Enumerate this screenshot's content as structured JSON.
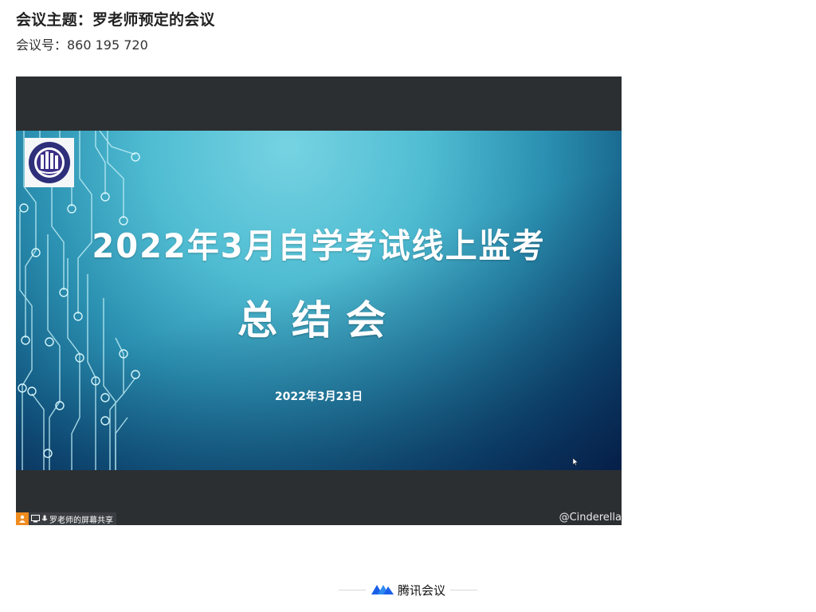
{
  "meeting": {
    "title": "会议主题：罗老师预定的会议",
    "id_line": "会议号：860 195 720"
  },
  "slide": {
    "title": "2022年3月自学考试线上监考",
    "subtitle": "总结会",
    "date": "2022年3月23日"
  },
  "share": {
    "label": "罗老师的屏幕共享",
    "watermark": "@Cinderella"
  },
  "footer": {
    "brand": "腾讯会议"
  },
  "colors": {
    "accent": "#f08b1e",
    "brand_blue": "#1a5fe8",
    "frame_bg": "#2b2f32"
  }
}
